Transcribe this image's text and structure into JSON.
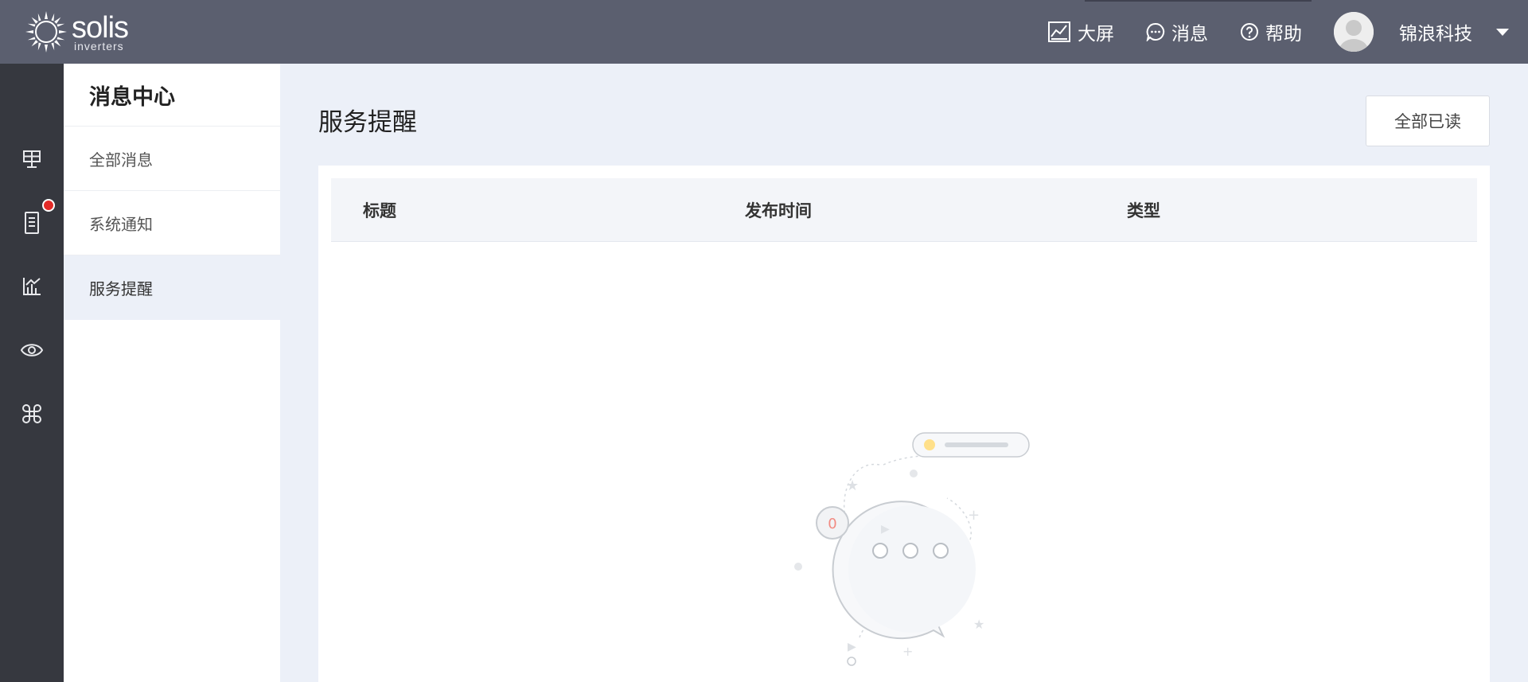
{
  "brand": {
    "name": "solis",
    "tagline": "inverters"
  },
  "topnav": {
    "items": [
      {
        "label": "大屏",
        "icon": "chart-screen-icon"
      },
      {
        "label": "消息",
        "icon": "message-icon"
      },
      {
        "label": "帮助",
        "icon": "help-icon"
      }
    ],
    "user_name": "锦浪科技"
  },
  "rail": {
    "items": [
      "solar-panel-icon",
      "inverter-icon",
      "analytics-icon",
      "eye-icon",
      "apps-icon"
    ],
    "notification_on": "inverter-icon",
    "notification_color": "#e22a27"
  },
  "submenu": {
    "title": "消息中心",
    "items": [
      {
        "label": "全部消息",
        "active": false
      },
      {
        "label": "系统通知",
        "active": false
      },
      {
        "label": "服务提醒",
        "active": true
      }
    ]
  },
  "main": {
    "title": "服务提醒",
    "read_all_label": "全部已读",
    "table": {
      "columns": [
        "标题",
        "发布时间",
        "类型"
      ],
      "rows": []
    },
    "empty_badge": "0"
  },
  "colors": {
    "topbar": "#5b5f6f",
    "rail": "#36383f",
    "page_bg": "#ecf0f8"
  }
}
